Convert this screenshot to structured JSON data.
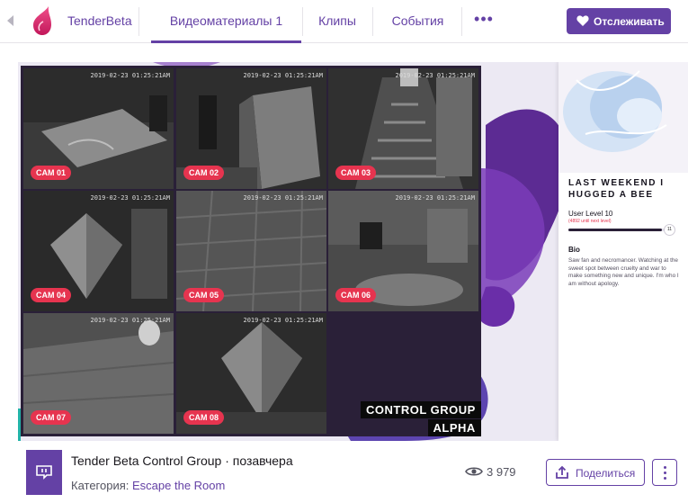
{
  "topnav": {
    "channel_name": "TenderBeta",
    "tabs": [
      {
        "label": "Видеоматериалы 1",
        "active": true
      },
      {
        "label": "Клипы",
        "active": false
      },
      {
        "label": "События",
        "active": false
      }
    ],
    "more_label": "•••",
    "follow_label": "Отслеживать"
  },
  "video": {
    "cams": [
      {
        "label": "CAM 01",
        "timestamp": "2019-02-23 01:25:21AM"
      },
      {
        "label": "CAM 02",
        "timestamp": "2019-02-23 01:25:21AM"
      },
      {
        "label": "CAM 03",
        "timestamp": "2019-02-23 01:25:21AM"
      },
      {
        "label": "CAM 04",
        "timestamp": "2019-02-23 01:25:21AM"
      },
      {
        "label": "CAM 05",
        "timestamp": "2019-02-23 01:25:21AM"
      },
      {
        "label": "CAM 06",
        "timestamp": "2019-02-23 01:25:21AM"
      },
      {
        "label": "CAM 07",
        "timestamp": "2019-02-23 01:25:21AM"
      },
      {
        "label": "CAM 08",
        "timestamp": "2019-02-23 01:25:21AM"
      }
    ],
    "control_group_line1": "CONTROL GROUP",
    "control_group_line2": "ALPHA",
    "profile": {
      "title": "LAST WEEKEND I HUGGED A BEE",
      "user_level": "User Level 10",
      "user_level_sub": "(4892 until next level)",
      "level_fraction": 0.9,
      "level_badge": "11",
      "bio_heading": "Bio",
      "bio_text": "Saw fan and necromancer. Watching at the sweet spot between cruelty and war to make something new and unique. I'm who I am without apology."
    }
  },
  "info": {
    "title": "Tender Beta Control Group · позавчера",
    "category_prefix": "Категория:",
    "category": "Escape the Room",
    "views": "3 979",
    "share_label": "Поделиться"
  },
  "colors": {
    "accent": "#6441a5",
    "cam_label": "#e6344f"
  }
}
